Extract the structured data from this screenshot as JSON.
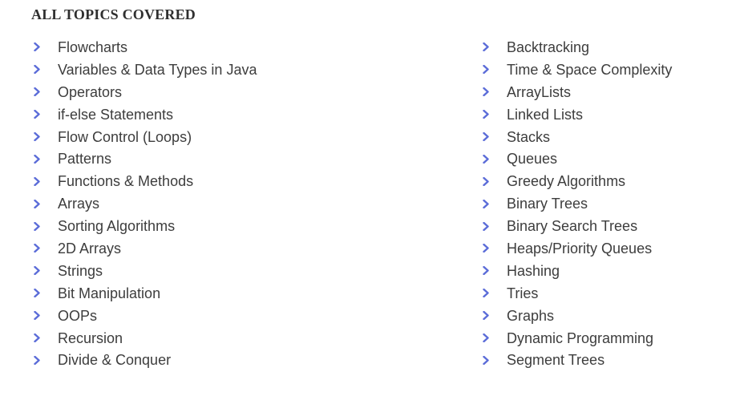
{
  "heading": "ALL TOPICS COVERED",
  "accent_color": "#5b6cd8",
  "icon": "chevron-right-icon",
  "left_topics": [
    "Flowcharts",
    "Variables & Data Types in Java",
    "Operators",
    "if-else Statements",
    "Flow Control (Loops)",
    "Patterns",
    "Functions & Methods",
    "Arrays",
    "Sorting Algorithms",
    "2D Arrays",
    "Strings",
    "Bit Manipulation",
    "OOPs",
    "Recursion",
    "Divide & Conquer"
  ],
  "right_topics": [
    "Backtracking",
    "Time & Space Complexity",
    "ArrayLists",
    "Linked Lists",
    "Stacks",
    "Queues",
    "Greedy Algorithms",
    "Binary Trees",
    "Binary Search Trees",
    "Heaps/Priority Queues",
    "Hashing",
    "Tries",
    "Graphs",
    "Dynamic Programming",
    "Segment Trees"
  ]
}
